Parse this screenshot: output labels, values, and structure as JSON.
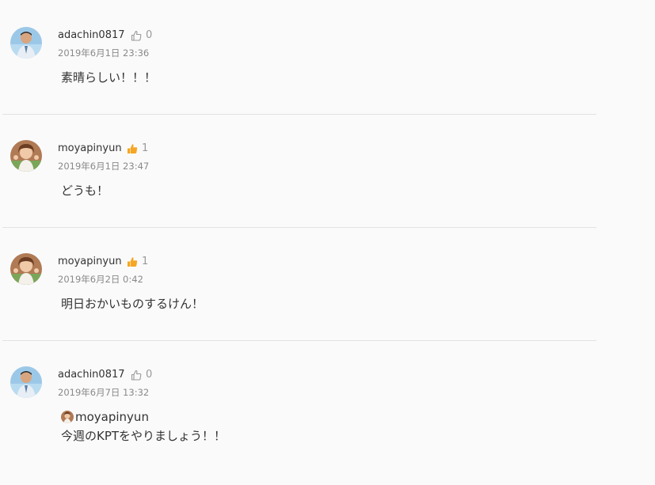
{
  "comments": [
    {
      "user": "adachin0817",
      "likes": "0",
      "liked": false,
      "date": "2019年6月1日 23:36",
      "text": "素晴らしい！！！"
    },
    {
      "user": "moyapinyun",
      "likes": "1",
      "liked": true,
      "date": "2019年6月1日 23:47",
      "text": "どうも！"
    },
    {
      "user": "moyapinyun",
      "likes": "1",
      "liked": true,
      "date": "2019年6月2日 0:42",
      "text": "明日おかいものするけん！"
    },
    {
      "user": "adachin0817",
      "likes": "0",
      "liked": false,
      "date": "2019年6月7日 13:32",
      "mention": "moyapinyun",
      "text": "今週のKPTをやりましょう！！"
    }
  ],
  "icons": {
    "like_outline": "thumbs-up-outline-icon",
    "like_filled": "thumbs-up-filled-icon"
  },
  "colors": {
    "like_active": "#f5a623",
    "like_inactive": "#999999",
    "divider": "#e2e2e2",
    "background": "#fafafa"
  }
}
